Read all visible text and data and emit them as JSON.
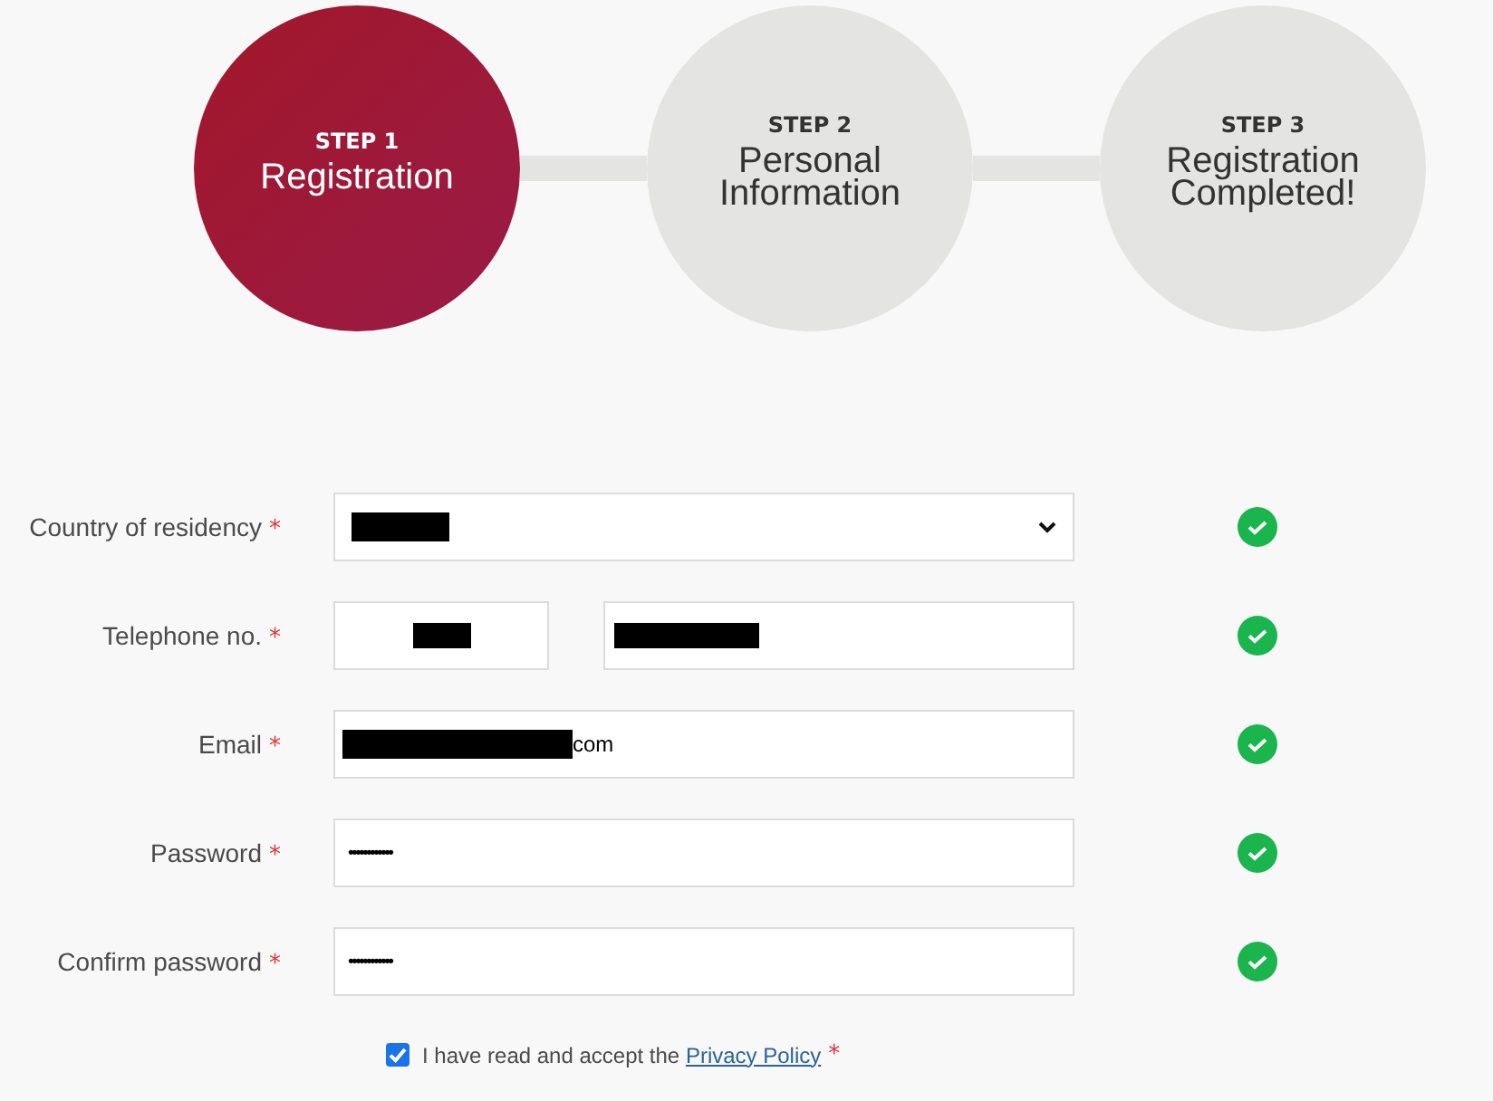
{
  "steps": [
    {
      "step_label": "STEP 1",
      "title": "Registration",
      "selected": true
    },
    {
      "step_label": "STEP 2",
      "title": "Personal Information",
      "selected": false
    },
    {
      "step_label": "STEP 3",
      "title": "Registration Completed!",
      "selected": false
    }
  ],
  "fields": [
    {
      "kind": "select",
      "label": "Country of residency",
      "required_mark": "*",
      "redacted": true,
      "valid": true
    },
    {
      "kind": "phone",
      "label": "Telephone no.",
      "required_mark": "*",
      "redacted": true,
      "valid": true
    },
    {
      "kind": "text",
      "label": "Email",
      "required_mark": "*",
      "redacted": true,
      "value": "com",
      "valid": true
    },
    {
      "kind": "password",
      "label": "Password",
      "required_mark": "*",
      "value": "••••••••••••",
      "valid": true
    },
    {
      "kind": "password",
      "label": "Confirm password",
      "required_mark": "*",
      "value": "••••••••••••",
      "valid": true
    }
  ],
  "consent": {
    "text": "I have read and accept the",
    "link": "Privacy Policy",
    "required_mark": "*",
    "checked": true
  }
}
